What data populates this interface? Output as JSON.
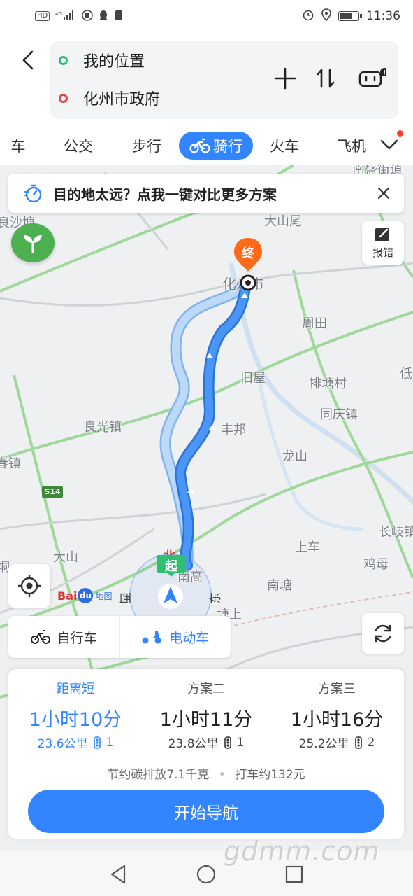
{
  "status_bar": {
    "left_indicators": [
      "HD",
      "4G",
      "signal",
      "app",
      "qq",
      "sd"
    ],
    "time": "11:36"
  },
  "route": {
    "start": "我的位置",
    "end": "化州市政府"
  },
  "tabs": [
    {
      "label": "车",
      "active": false
    },
    {
      "label": "公交",
      "active": false
    },
    {
      "label": "步行",
      "active": false
    },
    {
      "label": "骑行",
      "active": true
    },
    {
      "label": "火车",
      "active": false
    },
    {
      "label": "飞机",
      "active": false
    }
  ],
  "banner": {
    "text": "目的地太远？点我一键对比更多方案"
  },
  "map": {
    "report_label": "报错",
    "end_marker": "终",
    "start_marker": "起",
    "north_label": "北",
    "compass": {
      "west": "西",
      "east": "东"
    },
    "baidu_logo": {
      "prefix": "Bai",
      "du": "du",
      "suffix": "地图"
    },
    "road_badge": "S14",
    "places": [
      {
        "name": "南盛街道"
      },
      {
        "name": "大山尾"
      },
      {
        "name": "良沙塘"
      },
      {
        "name": "化州市"
      },
      {
        "name": "周田"
      },
      {
        "name": "旧屋"
      },
      {
        "name": "排塘村"
      },
      {
        "name": "低"
      },
      {
        "name": "同庆镇"
      },
      {
        "name": "良光镇"
      },
      {
        "name": "丰邦"
      },
      {
        "name": "龙山"
      },
      {
        "name": "春镇"
      },
      {
        "name": "大山"
      },
      {
        "name": "上车"
      },
      {
        "name": "长岐镇"
      },
      {
        "name": "鸡母"
      },
      {
        "name": "南塘"
      },
      {
        "name": "南高"
      },
      {
        "name": "塘上"
      },
      {
        "name": "垌"
      }
    ]
  },
  "bike_types": [
    {
      "label": "自行车",
      "active": false
    },
    {
      "label": "电动车",
      "active": true
    }
  ],
  "plans": [
    {
      "label": "距离短",
      "time": "1小时10分",
      "distance": "23.6公里",
      "lights": "1",
      "selected": true
    },
    {
      "label": "方案二",
      "time": "1小时11分",
      "distance": "23.8公里",
      "lights": "1",
      "selected": false
    },
    {
      "label": "方案三",
      "time": "1小时16分",
      "distance": "25.2公里",
      "lights": "2",
      "selected": false
    }
  ],
  "summary": {
    "carbon": "节约碳排放7.1千克",
    "taxi": "打车约132元"
  },
  "start_nav_label": "开始导航",
  "watermark": "gdmm.com",
  "colors": {
    "accent": "#3385ff",
    "route_main": "#3a8ef6",
    "route_alt": "#a9cdf5",
    "start_green": "#2fbf71",
    "end_orange": "#ff6a1a"
  }
}
